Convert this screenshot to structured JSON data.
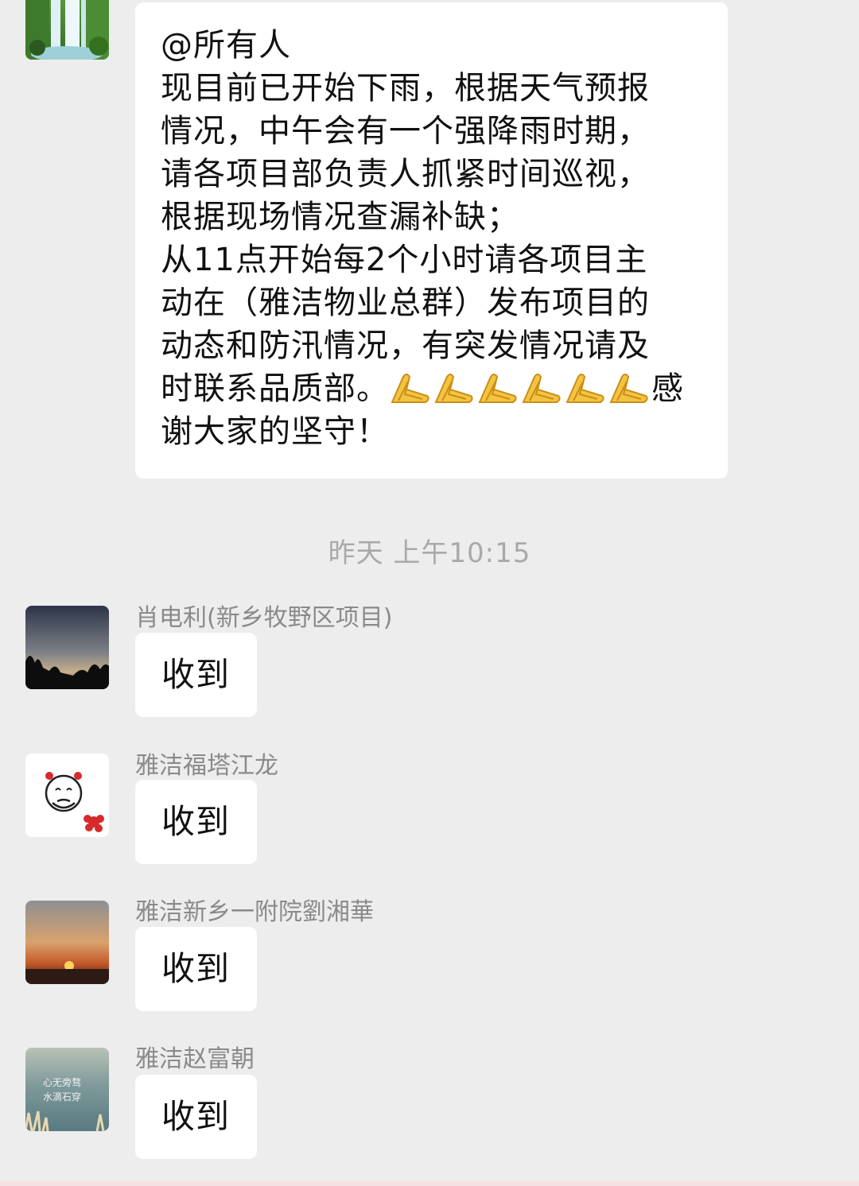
{
  "main_message": {
    "lines": [
      "@所有人",
      "现目前已开始下雨，根据天气预报",
      "情况，中午会有一个强降雨时期，",
      "请各项目部负责人抓紧时间巡视，",
      "根据现场情况查漏补缺；",
      "从11点开始每2个小时请各项目主",
      "动在（雅洁物业总群）发布项目的",
      "动态和防汛情况，有突发情况请及"
    ],
    "line_9_before": "时联系品质部。",
    "line_9_after": "感",
    "line_10": "谢大家的坚守！"
  },
  "timestamp": "昨天 上午10:15",
  "replies": [
    {
      "sender": "肖电利(新乡牧野区项目)",
      "text": "收到"
    },
    {
      "sender": "雅洁福塔江龙",
      "text": "收到"
    },
    {
      "sender": "雅洁新乡一附院劉湘華",
      "text": "收到"
    },
    {
      "sender": "雅洁赵富朝",
      "text": "收到"
    }
  ],
  "avatar_text": {
    "reply_4_line_1": "心无旁骛",
    "reply_4_line_2": "水滴石穿"
  },
  "colors": {
    "background": "#ededed",
    "bubble": "#ffffff",
    "text": "#111111",
    "name": "#8a8a8a",
    "timestamp": "#a9a9a9"
  },
  "icons": [
    "waterfall-avatar",
    "folded-hands-emoji",
    "sunset-trees-avatar",
    "cartoon-face-avatar",
    "sunset-avatar",
    "sea-text-avatar"
  ]
}
